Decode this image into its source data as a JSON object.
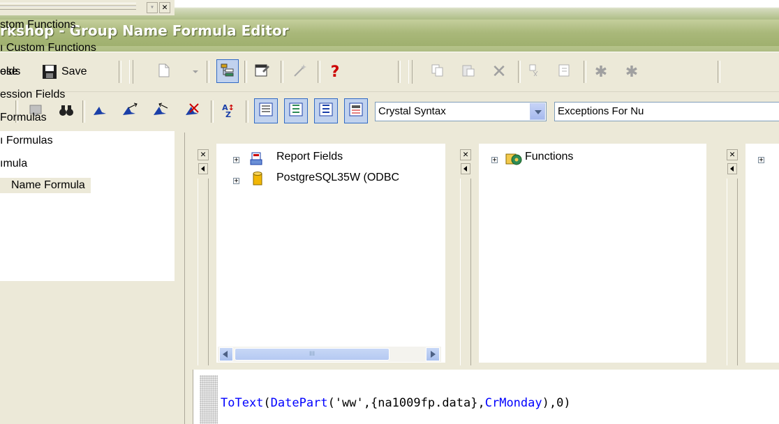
{
  "window": {
    "title": "rkshop - Group Name Formula Editor"
  },
  "toolbar1": {
    "close_label": "ose",
    "save_label": "Save"
  },
  "toolbar2": {
    "syntax_combo": {
      "value": "Crystal Syntax"
    },
    "null_combo": {
      "value": "Exceptions For Nu"
    }
  },
  "left_tree": {
    "items": [
      {
        "label": "stom Functions"
      },
      {
        "label": "ı Custom Functions"
      },
      {
        "label": "elds"
      },
      {
        "label": "ession Fields"
      },
      {
        "label": "Formulas"
      },
      {
        "label": "ı Formulas"
      },
      {
        "label": "ımula"
      },
      {
        "label": "Name Formula",
        "selected": true
      }
    ]
  },
  "fields_panel": {
    "items": [
      {
        "label": "Report Fields",
        "icon": "report-fields-icon"
      },
      {
        "label": "PostgreSQL35W (ODBC",
        "icon": "database-icon"
      }
    ],
    "scrollbar_thumb": "III"
  },
  "functions_panel": {
    "items": [
      {
        "label": "Functions",
        "icon": "functions-icon"
      }
    ]
  },
  "editor": {
    "code_tokens": [
      {
        "text": "ToText",
        "color": "#0000ff"
      },
      {
        "text": "(",
        "color": "#000000"
      },
      {
        "text": "DatePart",
        "color": "#0000ff"
      },
      {
        "text": "('ww',{na1009fp.data},",
        "color": "#000000"
      },
      {
        "text": "CrMonday",
        "color": "#0000ff"
      },
      {
        "text": "),0)",
        "color": "#000000"
      }
    ]
  },
  "colors": {
    "title_bar": "#a9b87a",
    "chrome": "#ece9d8",
    "keyword_blue": "#0000ff",
    "help_red": "#cc0000"
  }
}
